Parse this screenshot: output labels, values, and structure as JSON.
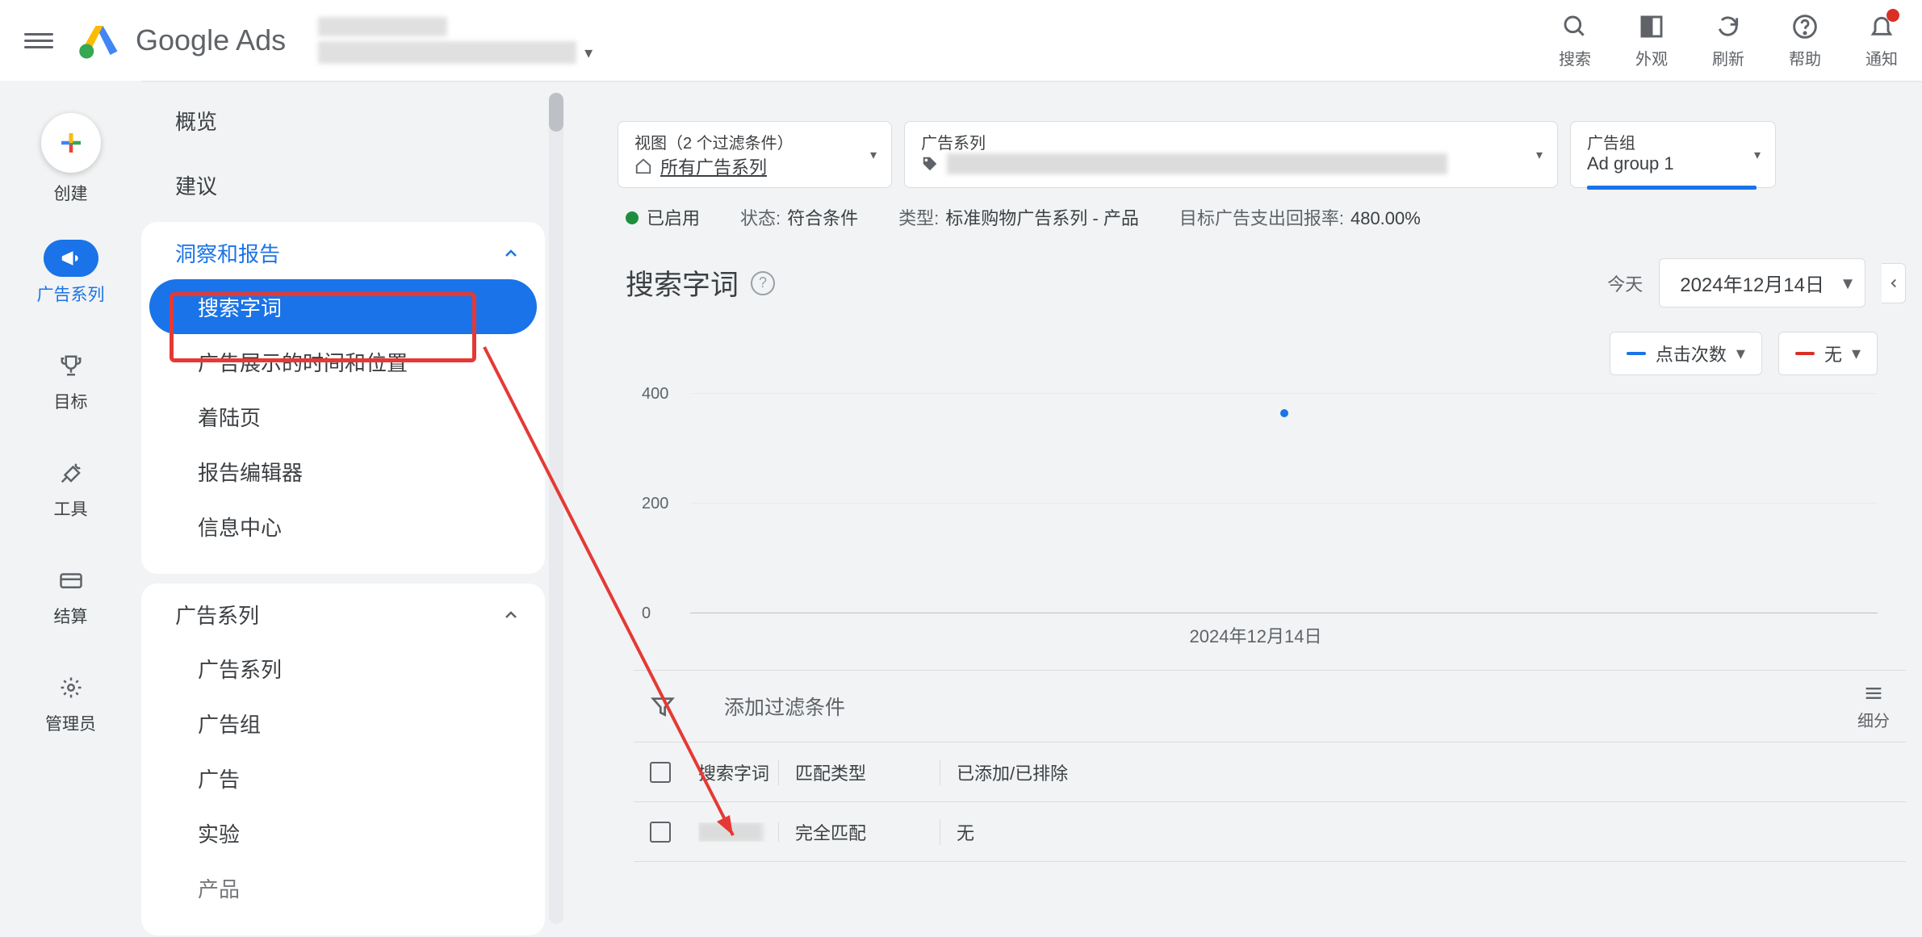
{
  "header": {
    "product_name": "Google Ads",
    "actions": {
      "search": "搜索",
      "appearance": "外观",
      "refresh": "刷新",
      "help": "帮助",
      "notifications": "通知"
    }
  },
  "rail": {
    "create": "创建",
    "campaigns": "广告系列",
    "goals": "目标",
    "tools": "工具",
    "billing": "结算",
    "admin": "管理员"
  },
  "nav": {
    "overview": "概览",
    "recommendations": "建议",
    "insights_header": "洞察和报告",
    "insights": {
      "search_terms": "搜索字词",
      "when_where": "广告展示的时间和位置",
      "landing_pages": "着陆页",
      "report_editor": "报告编辑器",
      "dashboards": "信息中心"
    },
    "campaigns_header": "广告系列",
    "campaigns": {
      "campaigns": "广告系列",
      "ad_groups": "广告组",
      "ads": "广告",
      "experiments": "实验",
      "products": "产品"
    }
  },
  "selectors": {
    "view_label": "视图（2 个过滤条件）",
    "view_value": "所有广告系列",
    "campaign_label": "广告系列",
    "adgroup_label": "广告组",
    "adgroup_value": "Ad group 1"
  },
  "status": {
    "enabled": "已启用",
    "status_label": "状态:",
    "status_value": "符合条件",
    "type_label": "类型:",
    "type_value": "标准购物广告系列 - 产品",
    "troas_label": "目标广告支出回报率:",
    "troas_value": "480.00%"
  },
  "page": {
    "title": "搜索字词",
    "today": "今天",
    "date": "2024年12月14日"
  },
  "metrics": {
    "primary": "点击次数",
    "secondary": "无"
  },
  "chart_data": {
    "type": "line",
    "x": [
      "2024年12月14日"
    ],
    "series": [
      {
        "name": "点击次数",
        "values": [
          370
        ]
      }
    ],
    "ylim": [
      0,
      400
    ],
    "yticks": [
      0,
      200,
      400
    ],
    "xlabel": "2024年12月14日"
  },
  "filter": {
    "placeholder": "添加过滤条件",
    "segment": "细分"
  },
  "table": {
    "headers": {
      "term": "搜索字词",
      "match": "匹配类型",
      "added": "已添加/已排除"
    },
    "rows": [
      {
        "match": "完全匹配",
        "added": "无"
      }
    ]
  }
}
